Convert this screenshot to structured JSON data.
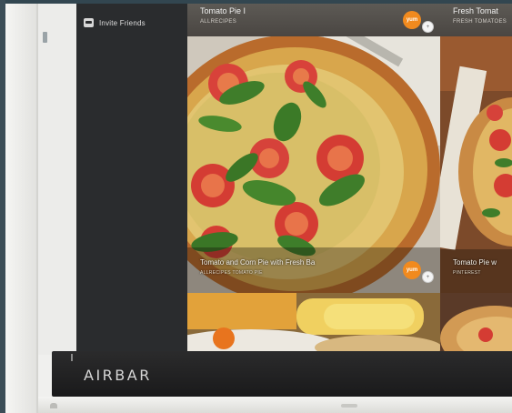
{
  "sidebar": {
    "invite_label": "Invite Friends",
    "invite_icon": "chat-icon"
  },
  "feed": {
    "tiles": [
      {
        "title": "Tomato Pie I",
        "subtitle": "ALLRECIPES",
        "badge": "yum"
      },
      {
        "title": "Fresh Tomat",
        "subtitle": "FRESH TOMATOES",
        "badge": ""
      },
      {
        "title": "Tomato and Corn Pie with Fresh Ba",
        "subtitle": "ALLRECIPES TOMATO PIE",
        "badge": "yum"
      },
      {
        "title": "Tomato Pie w",
        "subtitle": "PINTEREST",
        "badge": ""
      }
    ],
    "badge_small": "+"
  },
  "airbar": {
    "brand": "AIRBAR"
  },
  "colors": {
    "accent_badge": "#f18a1e",
    "sidebar_bg": "#2a2c2e",
    "bar_bg": "#1a1a1b"
  }
}
